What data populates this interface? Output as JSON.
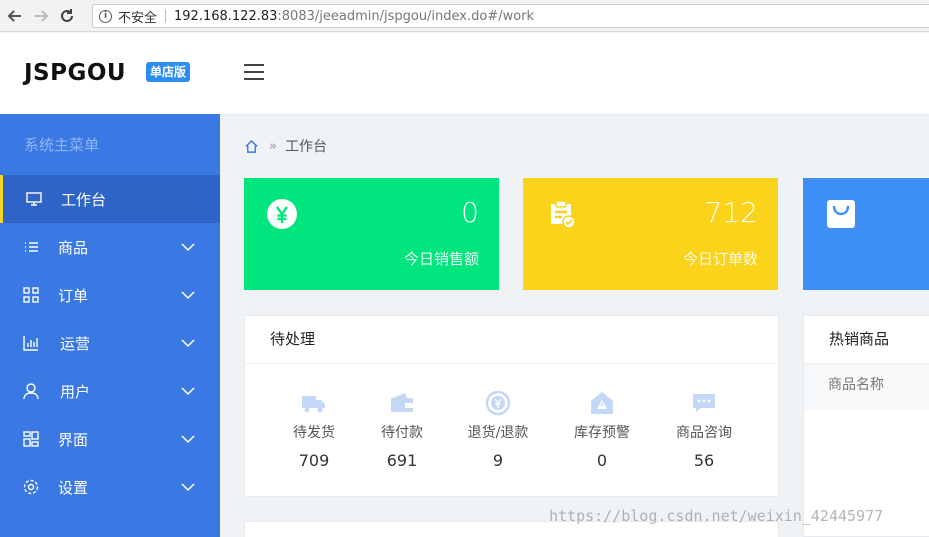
{
  "browser": {
    "security_label": "不安全",
    "url_host": "192.168.122.83",
    "url_rest": ":8083/jeeadmin/jspgou/index.do#/work"
  },
  "header": {
    "logo": "JSPGOU",
    "edition_badge": "单店版"
  },
  "sidebar": {
    "title": "系统主菜单",
    "items": [
      {
        "label": "工作台",
        "icon": "monitor-icon",
        "active": true
      },
      {
        "label": "商品",
        "icon": "list-icon"
      },
      {
        "label": "订单",
        "icon": "grid-icon"
      },
      {
        "label": "运营",
        "icon": "bar-chart-icon"
      },
      {
        "label": "用户",
        "icon": "user-icon"
      },
      {
        "label": "界面",
        "icon": "layout-icon"
      },
      {
        "label": "设置",
        "icon": "gear-icon"
      }
    ]
  },
  "breadcrumb": {
    "current": "工作台"
  },
  "stats": [
    {
      "value": "0",
      "label": "今日销售额",
      "color": "#00e57e",
      "icon": "yen-icon"
    },
    {
      "value": "712",
      "label": "今日订单数",
      "color": "#fbd31b",
      "icon": "clipboard-check-icon"
    },
    {
      "value": "",
      "label": "",
      "color": "#3d8ef5",
      "icon": "bag-icon"
    }
  ],
  "pending": {
    "title": "待处理",
    "items": [
      {
        "label": "待发货",
        "value": "709",
        "icon": "truck-icon"
      },
      {
        "label": "待付款",
        "value": "691",
        "icon": "wallet-icon"
      },
      {
        "label": "退货/退款",
        "value": "9",
        "icon": "refund-icon"
      },
      {
        "label": "库存预警",
        "value": "0",
        "icon": "warning-icon"
      },
      {
        "label": "商品咨询",
        "value": "56",
        "icon": "chat-icon"
      }
    ]
  },
  "hot_products": {
    "title": "热销商品",
    "column": "商品名称"
  },
  "watermark": "https://blog.csdn.net/weixin_42445977",
  "colors": {
    "sidebar": "#3a78e3",
    "sidebar_active": "#2f65c6",
    "accent_bar": "#f9d423",
    "badge": "#2d8cf0",
    "pending_icon": "#c3d8f7"
  }
}
